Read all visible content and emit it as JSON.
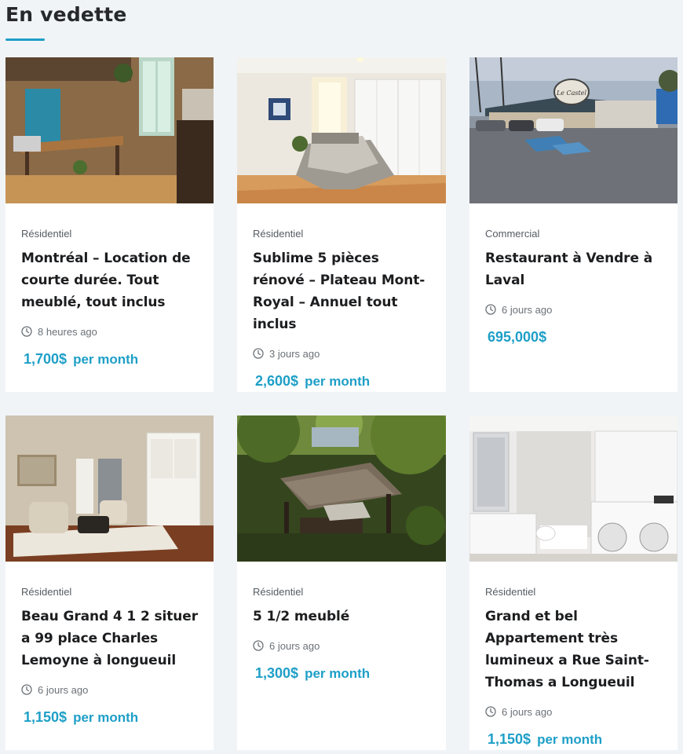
{
  "section": {
    "title": "En vedette"
  },
  "listings": [
    {
      "category": "Résidentiel",
      "title": "Montréal – Location de courte durée. Tout meublé, tout inclus",
      "time": "8 heures ago",
      "price": "1,700$",
      "period": "per month"
    },
    {
      "category": "Résidentiel",
      "title": "Sublime 5 pièces rénové – Plateau Mont-Royal – Annuel tout inclus",
      "time": "3 jours ago",
      "price": "2,600$",
      "period": "per month"
    },
    {
      "category": "Commercial",
      "title": "Restaurant à Vendre à Laval",
      "time": "6 jours ago",
      "price": "695,000$",
      "period": ""
    },
    {
      "category": "Résidentiel",
      "title": "Beau Grand 4 1 2 situer a 99 place Charles Lemoyne à longueuil",
      "time": "6 jours ago",
      "price": "1,150$",
      "period": "per month"
    },
    {
      "category": "Résidentiel",
      "title": "5 1/2 meublé",
      "time": "6 jours ago",
      "price": "1,300$",
      "period": "per month"
    },
    {
      "category": "Résidentiel",
      "title": "Grand et bel Appartement très lumineux a Rue Saint-Thomas a Longueuil",
      "time": "6 jours ago",
      "price": "1,150$",
      "period": "per month"
    }
  ],
  "photos": [
    {
      "label": "Le Castel"
    }
  ],
  "colors": {
    "accent": "#1e9fc7",
    "background": "#f1f4f7"
  },
  "icons": {
    "time": "clock-icon"
  }
}
